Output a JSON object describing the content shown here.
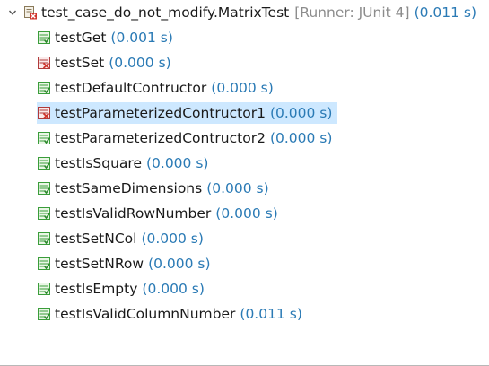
{
  "colors": {
    "pass_green": "#3a9d3a",
    "fail_red": "#d0342c",
    "time_blue": "#2a7ab5",
    "selection": "#cde8ff",
    "runner_gray": "#8c8c8c"
  },
  "root": {
    "name": "test_case_do_not_modify.MatrixTest",
    "runner": "[Runner: JUnit 4]",
    "time": "(0.011 s)",
    "status": "failed",
    "expanded": true,
    "icon": "test-suite-error-icon"
  },
  "tests": [
    {
      "name": "testGet",
      "time": "(0.001 s)",
      "status": "passed"
    },
    {
      "name": "testSet",
      "time": "(0.000 s)",
      "status": "failed"
    },
    {
      "name": "testDefaultContructor",
      "time": "(0.000 s)",
      "status": "passed"
    },
    {
      "name": "testParameterizedContructor1",
      "time": "(0.000 s)",
      "status": "failed",
      "selected": true
    },
    {
      "name": "testParameterizedContructor2",
      "time": "(0.000 s)",
      "status": "passed"
    },
    {
      "name": "testIsSquare",
      "time": "(0.000 s)",
      "status": "passed"
    },
    {
      "name": "testSameDimensions",
      "time": "(0.000 s)",
      "status": "passed"
    },
    {
      "name": "testIsValidRowNumber",
      "time": "(0.000 s)",
      "status": "passed"
    },
    {
      "name": "testSetNCol",
      "time": "(0.000 s)",
      "status": "passed"
    },
    {
      "name": "testSetNRow",
      "time": "(0.000 s)",
      "status": "passed"
    },
    {
      "name": "testIsEmpty",
      "time": "(0.000 s)",
      "status": "passed"
    },
    {
      "name": "testIsValidColumnNumber",
      "time": "(0.011 s)",
      "status": "passed"
    }
  ]
}
